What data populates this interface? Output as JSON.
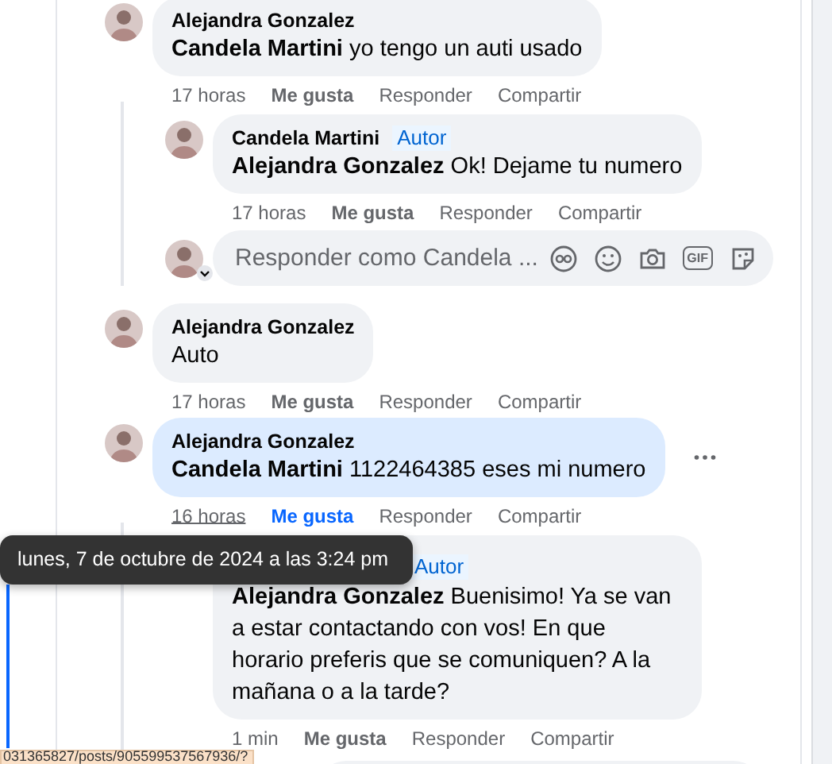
{
  "comments": [
    {
      "author": "Alejandra Gonzalez",
      "text": "**Candela Martini** yo tengo un auti usado",
      "time": "17 horas",
      "time_hovered": false,
      "like": "Me gusta",
      "liked": false,
      "reply": "Responder",
      "share": "Compartir",
      "highlighted": false,
      "menu_visible": false,
      "children": [
        {
          "author": "Candela Martini",
          "badge": "Autor",
          "text": "**Alejandra Gonzalez** Ok! Dejame tu numero",
          "time": "17 horas",
          "time_hovered": false,
          "like": "Me gusta",
          "liked": false,
          "reply": "Responder",
          "share": "Compartir",
          "highlighted": false,
          "menu_visible": false
        }
      ],
      "reply_box": {
        "placeholder": "Responder como Candela ...",
        "gif_label": "GIF"
      }
    },
    {
      "author": "Alejandra Gonzalez",
      "text": "Auto",
      "time": "17 horas",
      "time_hovered": false,
      "like": "Me gusta",
      "liked": false,
      "reply": "Responder",
      "share": "Compartir",
      "highlighted": false,
      "menu_visible": false
    },
    {
      "author": "Alejandra Gonzalez",
      "text": "**Candela Martini** 1122464385 eses mi numero",
      "time": "16 horas",
      "time_hovered": true,
      "like": "Me gusta",
      "liked": true,
      "reply": "Responder",
      "share": "Compartir",
      "highlighted": true,
      "menu_visible": true,
      "children": [
        {
          "badge": "Autor",
          "text": "**Alejandra Gonzalez** Buenisimo! Ya se van a estar contactando con vos! En que horario preferis que se comuniquen? A la mañana o a la tarde?",
          "time": "1 min",
          "time_hovered": false,
          "like": "Me gusta",
          "liked": false,
          "reply": "Responder",
          "share": "Compartir",
          "highlighted": false,
          "menu_visible": false
        }
      ]
    }
  ],
  "tooltip": {
    "text": "lunes, 7 de octubre de 2024 a las 3:24 pm"
  },
  "status_bar": {
    "url": "031365827/posts/905599537567936/?"
  }
}
